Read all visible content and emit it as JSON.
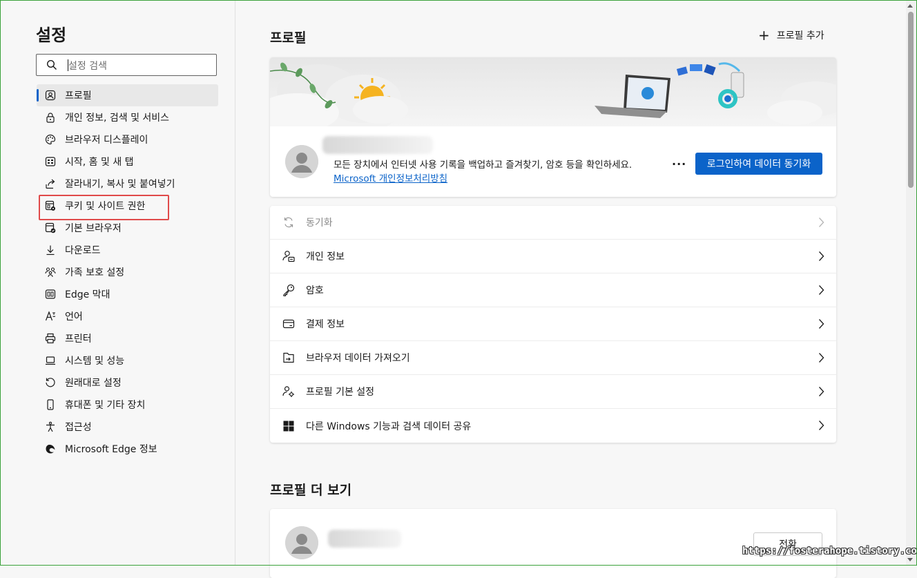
{
  "sidebar": {
    "title": "설정",
    "search_placeholder": "설정 검색",
    "items": [
      {
        "label": "프로필",
        "icon": "profile-icon"
      },
      {
        "label": "개인 정보, 검색 및 서비스",
        "icon": "lock-icon"
      },
      {
        "label": "브라우저 디스플레이",
        "icon": "palette-icon"
      },
      {
        "label": "시작, 홈 및 새 탭",
        "icon": "home-grid-icon"
      },
      {
        "label": "잘라내기, 복사 및 붙여넣기",
        "icon": "share-icon"
      },
      {
        "label": "쿠키 및 사이트 권한",
        "icon": "cookie-permissions-icon"
      },
      {
        "label": "기본 브라우저",
        "icon": "default-browser-icon"
      },
      {
        "label": "다운로드",
        "icon": "download-icon"
      },
      {
        "label": "가족 보호 설정",
        "icon": "family-icon"
      },
      {
        "label": "Edge 막대",
        "icon": "edge-bar-icon"
      },
      {
        "label": "언어",
        "icon": "language-icon"
      },
      {
        "label": "프린터",
        "icon": "printer-icon"
      },
      {
        "label": "시스템 및 성능",
        "icon": "laptop-icon"
      },
      {
        "label": "원래대로 설정",
        "icon": "reset-icon"
      },
      {
        "label": "휴대폰 및 기타 장치",
        "icon": "phone-icon"
      },
      {
        "label": "접근성",
        "icon": "accessibility-icon"
      },
      {
        "label": "Microsoft Edge 정보",
        "icon": "edge-logo-icon"
      }
    ]
  },
  "main": {
    "profile_section_title": "프로필",
    "add_profile_label": "프로필 추가",
    "profile_card": {
      "description": "모든 장치에서 인터넷 사용 기록을 백업하고 즐겨찾기, 암호 등을 확인하세요.",
      "privacy_link": "Microsoft 개인정보처리방침",
      "more_label": "···",
      "sync_button": "로그인하여 데이터 동기화"
    },
    "settings_rows": [
      {
        "label": "동기화",
        "icon": "sync-icon",
        "disabled": true
      },
      {
        "label": "개인 정보",
        "icon": "personal-info-icon"
      },
      {
        "label": "암호",
        "icon": "key-icon"
      },
      {
        "label": "결제 정보",
        "icon": "credit-card-icon"
      },
      {
        "label": "브라우저 데이터 가져오기",
        "icon": "import-icon"
      },
      {
        "label": "프로필 기본 설정",
        "icon": "profile-settings-icon"
      },
      {
        "label": "다른 Windows 기능과 검색 데이터 공유",
        "icon": "windows-icon"
      }
    ],
    "more_profiles_title": "프로필 더 보기",
    "switch_button": "전환"
  },
  "watermark": "https://fosterahope.tistory.com",
  "colors": {
    "accent": "#0b63c9",
    "highlight": "#e04a4a",
    "frame": "#3aa23a"
  }
}
